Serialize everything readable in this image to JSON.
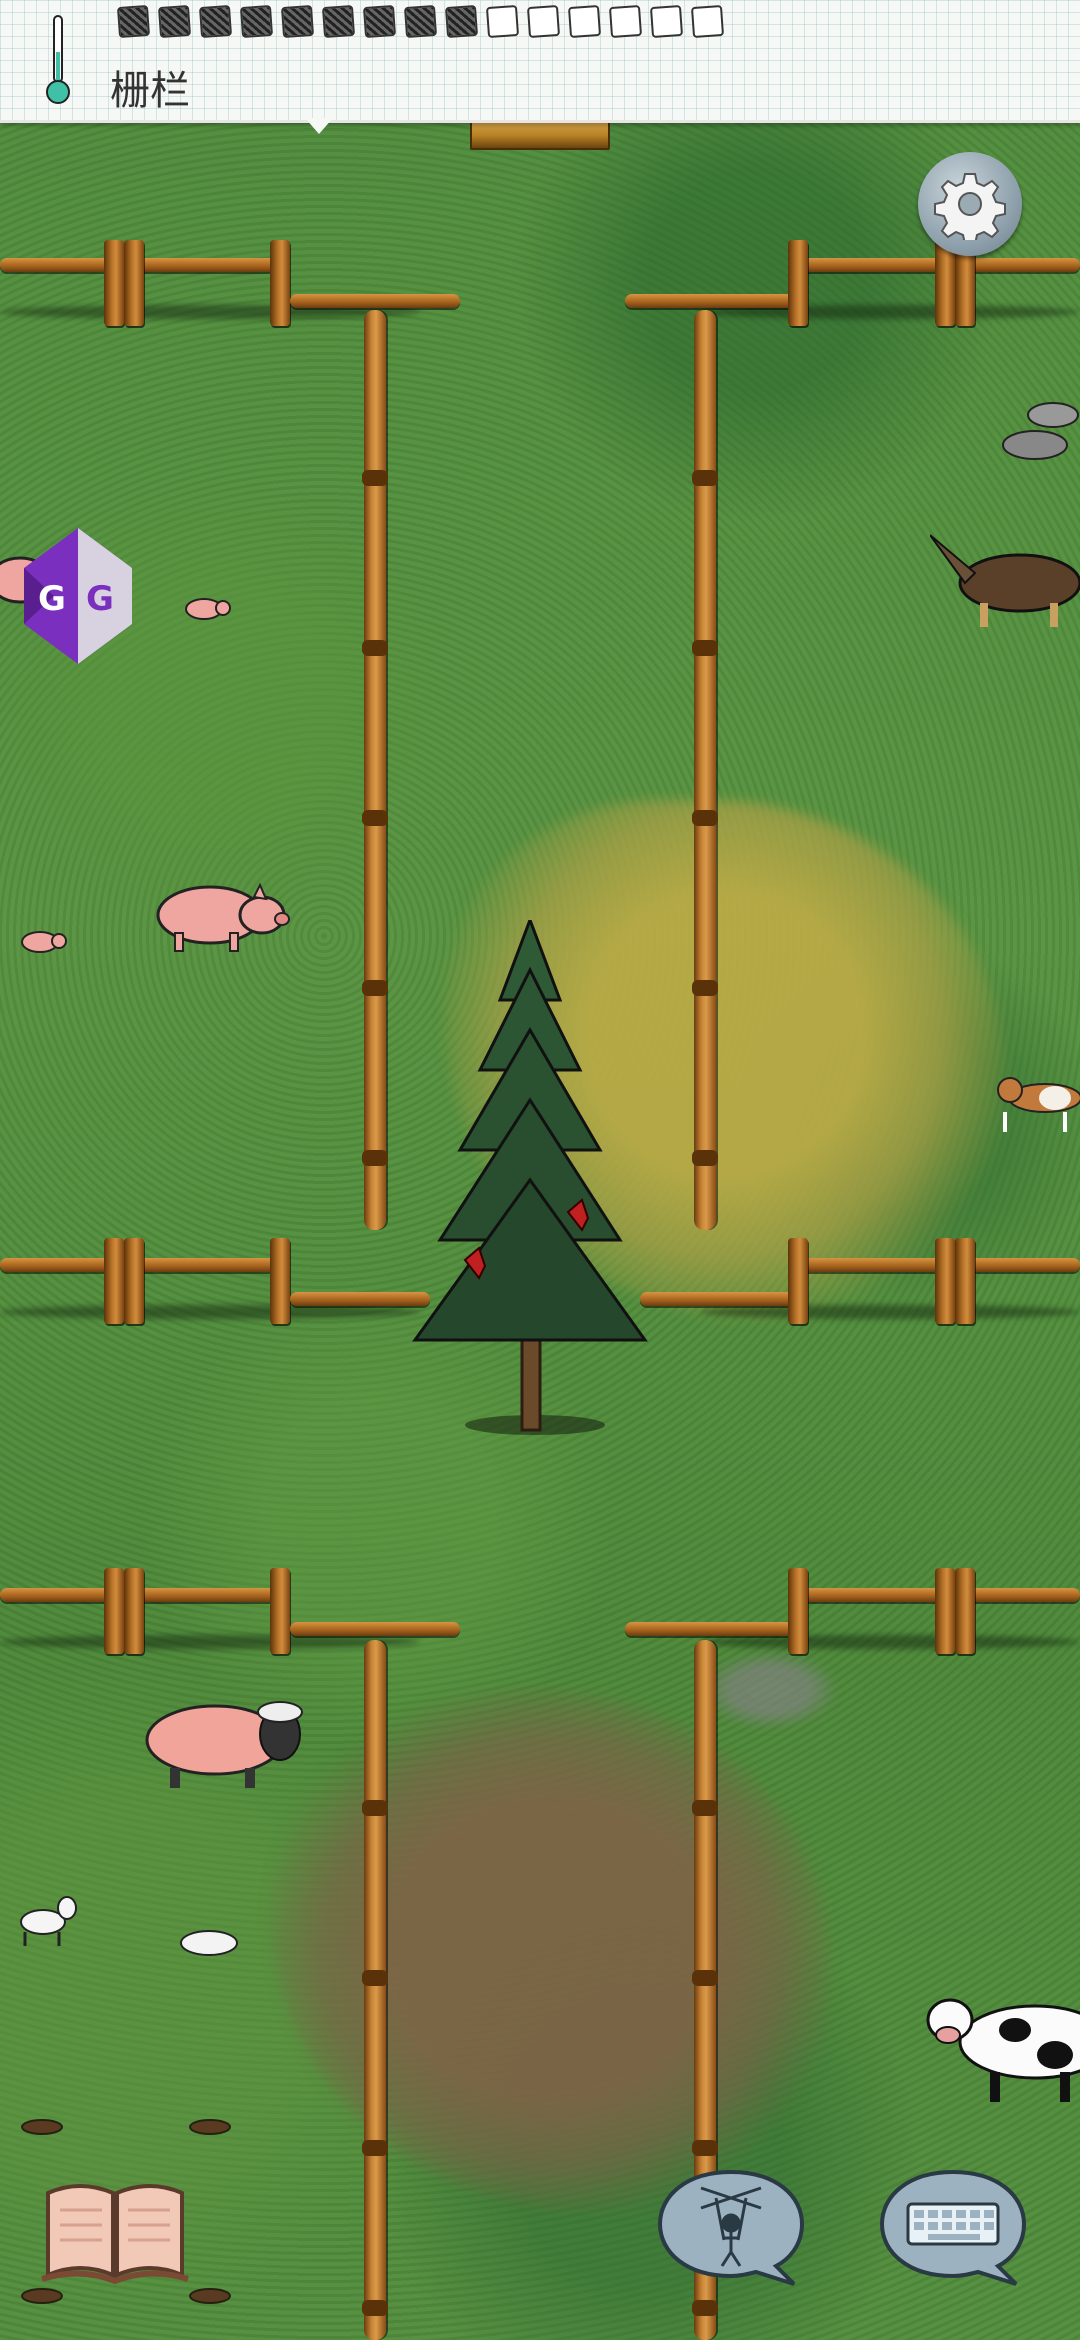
{
  "top_bar": {
    "biome_label": "栅栏",
    "thermometer_icon": "thermometer-icon",
    "food_meter": {
      "total": 15,
      "filled": 9
    }
  },
  "buttons": {
    "settings_icon": "gear-icon",
    "gg_overlay_label": "GG",
    "recipe_book_icon": "open-book-icon",
    "puppet_icon": "puppet-marionette-icon",
    "keyboard_icon": "keyboard-icon"
  },
  "colors": {
    "grass": "#4f8b3b",
    "fence_wood": "#b97429",
    "top_bar_bg": "#f5f8f5",
    "gg_purple": "#7b2fbe"
  },
  "scene": {
    "animals": [
      "pig",
      "pig",
      "piglet",
      "piglet",
      "sheep",
      "lamb",
      "goat",
      "dog",
      "dog",
      "wolf",
      "beagle",
      "cow"
    ],
    "objects": [
      "spruce-tree",
      "cardinal-bird",
      "fence"
    ]
  }
}
